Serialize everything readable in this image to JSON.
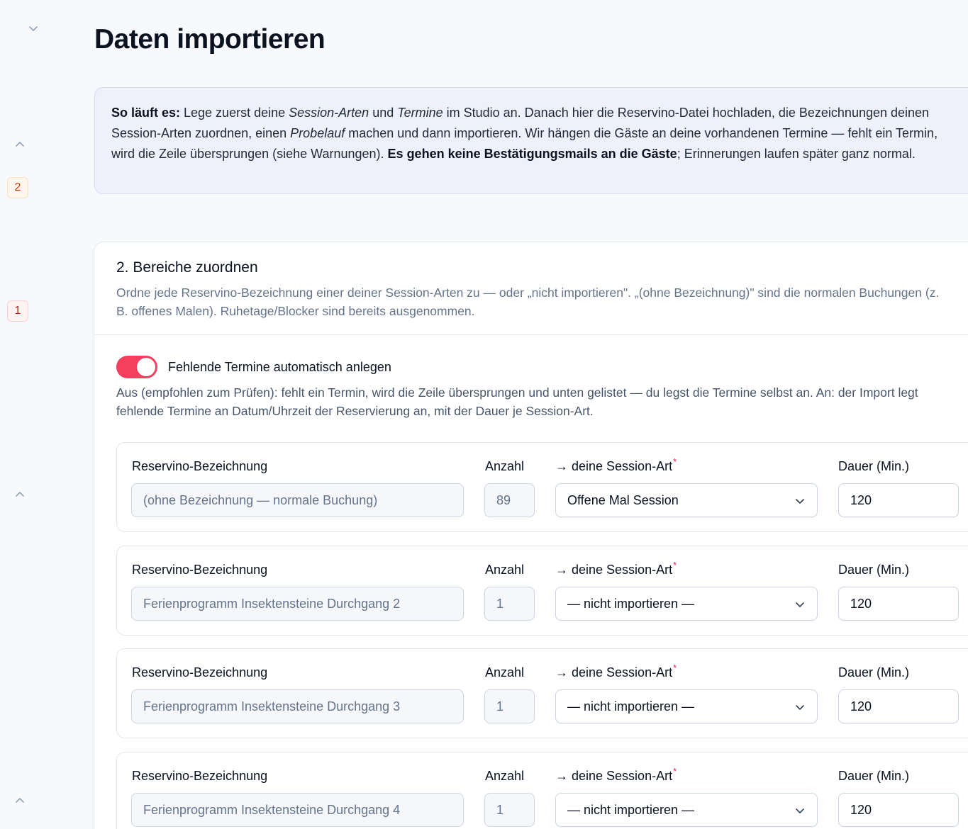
{
  "page": {
    "title": "Daten importieren"
  },
  "rail": {
    "badges": [
      "2",
      "1"
    ]
  },
  "info": {
    "lead": "So läuft es:",
    "t1": " Lege zuerst deine ",
    "session_arten": "Session-Arten",
    "t2": " und ",
    "termine": "Termine",
    "t3": " im Studio an. Danach hier die Reservino-Datei hochladen, die Bezeichnungen deinen Session-Arten zuordnen, einen ",
    "probelauf": "Probelauf",
    "t4": " machen und dann importieren. Wir hängen die Gäste an deine vorhandenen Termine — fehlt ein Termin, wird die Zeile übersprungen (siehe Warnungen). ",
    "strong": "Es gehen keine Bestätigungsmails an die Gäste",
    "t5": "; Erinnerungen laufen später ganz normal."
  },
  "section": {
    "title": "2. Bereiche zuordnen",
    "description": "Ordne jede Reservino-Bezeichnung einer deiner Session-Arten zu — oder „nicht importieren\". „(ohne Bezeichnung)\" sind die normalen Buchungen (z. B. offenes Malen). Ruhetage/Blocker sind bereits ausgenommen."
  },
  "toggle": {
    "label": "Fehlende Termine automatisch anlegen",
    "checked": true,
    "help": "Aus (empfohlen zum Prüfen): fehlt ein Termin, wird die Zeile übersprungen und unten gelistet — du legst die Termine selbst an. An: der Import legt fehlende Termine an Datum/Uhrzeit der Reservierung an, mit der Dauer je Session-Art."
  },
  "columns": {
    "name": "Reservino-Bezeichnung",
    "count": "Anzahl",
    "session": "→ deine Session-Art",
    "required_mark": "*",
    "duration": "Dauer (Min.)"
  },
  "rows": [
    {
      "name": "(ohne Bezeichnung — normale Buchung)",
      "count": "89",
      "session": "Offene Mal Session",
      "duration": "120"
    },
    {
      "name": "Ferienprogramm Insektensteine Durchgang 2",
      "count": "1",
      "session": "— nicht importieren —",
      "duration": "120"
    },
    {
      "name": "Ferienprogramm Insektensteine Durchgang 3",
      "count": "1",
      "session": "— nicht importieren —",
      "duration": "120"
    },
    {
      "name": "Ferienprogramm Insektensteine Durchgang 4",
      "count": "1",
      "session": "— nicht importieren —",
      "duration": "120"
    }
  ],
  "colors": {
    "accent": "#f43f5e",
    "info_bg": "#eef0fb"
  }
}
